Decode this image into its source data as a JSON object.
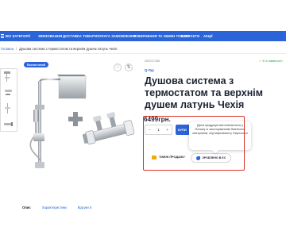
{
  "nav": {
    "items": [
      "ВСІ КАТЕГОРІЇ",
      "ЗВЯЗОВАННЯ",
      "ДОСТАВКА ТОВАРУ",
      "ОПЛАТА ЗАМОВЛЕННЯ",
      "ПОВЕРНЕННЯ ТА ОБМІН ТОВАРУ",
      "КОНТАКТИ",
      "АКЦІЇ"
    ]
  },
  "breadcrumb": {
    "home": "Головна",
    "separator": "/",
    "current": "Душова система з термостатом та верхнім душем латунь Чехія"
  },
  "gallery": {
    "badge": "Екологічний",
    "wishlist_icon": "heart-icon",
    "compare_icon": "compare-icon"
  },
  "product": {
    "sku": "000017066",
    "stock": "✓ Є в наявності",
    "brand": "Q-Tap",
    "title": "Душова система з термостатом та верхнім душем латунь Чехія",
    "price": "6499грн."
  },
  "cart": {
    "qty_minus": "−",
    "qty_value": "1",
    "qty_plus": "+",
    "buy_label": "КУПИ"
  },
  "actions": {
    "fast_label": "ТИЖНІ ПРОДАЖУ",
    "eco_label": "ЗРОБЛЕНО В ЄС"
  },
  "tooltip": {
    "text": "Дана продукція виготовляється у Польщі із застосуванням безпечних матеріалів, сертифікована у Євросоюзі"
  },
  "tabs": [
    "Опис",
    "Характеристики",
    "Відгуки 0"
  ],
  "colors": {
    "brand_blue": "#2b63d9",
    "highlight_red": "#d9342b",
    "stock_green": "#2e9e4a"
  }
}
